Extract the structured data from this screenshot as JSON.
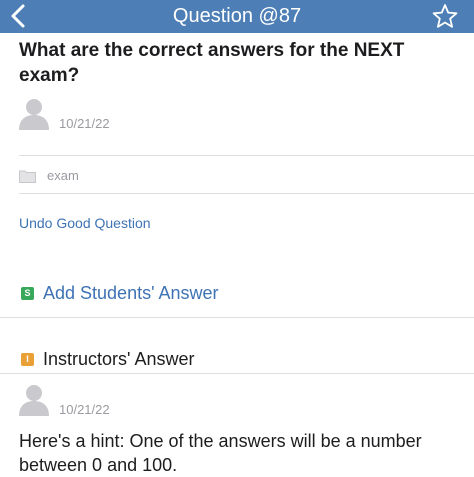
{
  "nav": {
    "title": "Question @87"
  },
  "question": {
    "title": "What are the correct answers for the NEXT exam?",
    "date": "10/21/22",
    "folder": "exam",
    "undo_label": "Undo Good Question"
  },
  "students_answer": {
    "badge": "S",
    "label": "Add Students' Answer"
  },
  "instructors_answer": {
    "badge": "I",
    "label": "Instructors' Answer",
    "date": "10/21/22",
    "text": "Here's a hint: One of the answers will be a number between 0 and 100."
  },
  "colors": {
    "nav_bar": "#4d7fb6",
    "link": "#3f73b4",
    "students_badge": "#38a85a",
    "instructors_badge": "#e8a037"
  }
}
